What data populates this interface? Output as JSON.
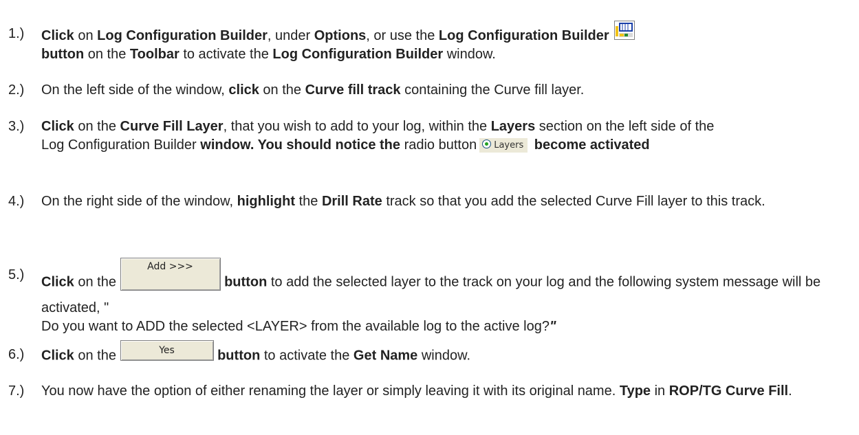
{
  "steps": [
    {
      "num": "1.)",
      "icon": "log-configuration-builder-icon",
      "t": [
        "Click",
        " on ",
        "Log Configuration Builder",
        ", under ",
        "Options",
        ", or use the ",
        "Log Configuration Builder",
        "button",
        " on the ",
        "Toolbar",
        " to activate the ",
        "Log Configuration Builder",
        " window."
      ]
    },
    {
      "num": "2.)",
      "t": [
        "On the left side of the window, ",
        "click",
        " on the ",
        "Curve fill track",
        " containing the Curve fill layer."
      ]
    },
    {
      "num": "3.)",
      "t": [
        "Click",
        " on the ",
        "Curve Fill Layer",
        ", that you wish to add to your log, within the ",
        "Layers",
        " section on the left side of the ",
        "Log Configuration Builder",
        " window. You should notice the ",
        "radio button",
        " become activated"
      ],
      "radio_label": "Layers"
    },
    {
      "num": "4.)",
      "t": [
        "On the right side of the window, ",
        "highlight",
        " the ",
        "Drill Rate",
        " track so that you add the selected Curve Fill layer to this track."
      ]
    },
    {
      "num": "5.)",
      "t": [
        "Click",
        " on the ",
        "button",
        " to add the selected layer to the track on your log and the following system message will be activated, \"",
        "Do you want to ADD the selected <LAYER> from the available log to the active log?",
        "\""
      ],
      "button_label": "Add >>>"
    },
    {
      "num": "6.)",
      "t": [
        "Click",
        " on the ",
        "button",
        " to activate the ",
        "Get Name",
        " window."
      ],
      "button_label": "Yes"
    },
    {
      "num": "7.)",
      "t": [
        "You now have the option of either renaming the layer or simply leaving it with its original name. ",
        "Type",
        " in ",
        "ROP/TG Curve Fill",
        "."
      ]
    }
  ]
}
